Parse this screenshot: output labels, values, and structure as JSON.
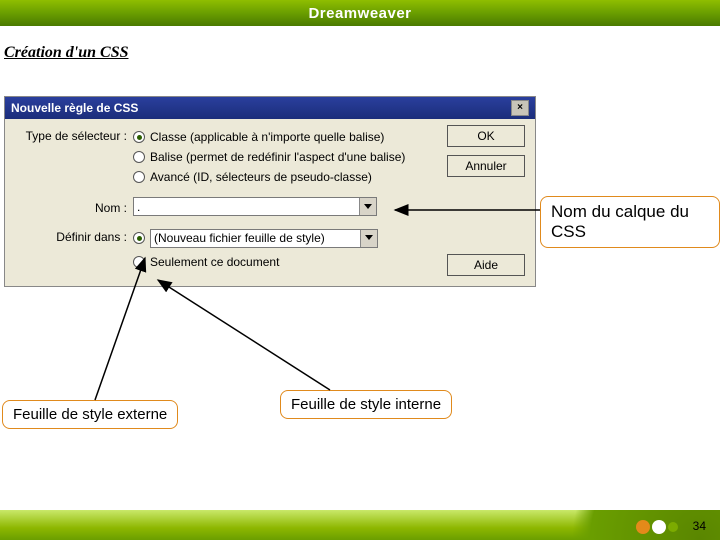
{
  "banner": {
    "title": "Dreamweaver"
  },
  "heading": "Création d'un CSS",
  "dialog": {
    "title": "Nouvelle règle de CSS",
    "labels": {
      "selector_type": "Type de sélecteur :",
      "name": "Nom :",
      "define_in": "Définir dans :"
    },
    "selector_options": {
      "class": "Classe (applicable à n'importe quelle balise)",
      "tag": "Balise (permet de redéfinir l'aspect d'une balise)",
      "advanced": "Avancé (ID, sélecteurs de pseudo-classe)"
    },
    "name_value": ".",
    "define_options": {
      "new_file": "(Nouveau fichier feuille de style)",
      "this_doc": "Seulement ce document"
    },
    "buttons": {
      "ok": "OK",
      "cancel": "Annuler",
      "help": "Aide"
    }
  },
  "callouts": {
    "name": "Nom du calque du CSS",
    "external": "Feuille de style externe",
    "internal": "Feuille de style interne"
  },
  "page_number": "34"
}
